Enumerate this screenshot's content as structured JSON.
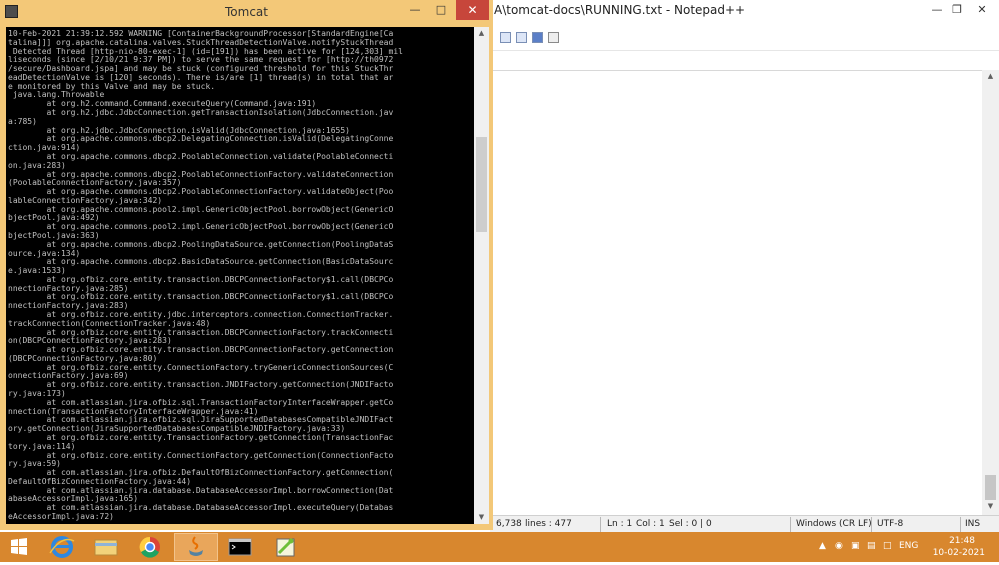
{
  "notepad": {
    "title": "A\\tomcat-docs\\RUNNING.txt - Notepad++",
    "status": {
      "length": "6,738",
      "lines": "lines : 477",
      "ln": "Ln : 1",
      "col": "Col : 1",
      "sel": "Sel : 0 | 0",
      "eol": "Windows (CR LF)",
      "encoding": "UTF-8",
      "mode": "INS"
    }
  },
  "tomcat": {
    "title": "Tomcat",
    "console_lines": [
      "10-Feb-2021 21:39:12.592 WARNING [ContainerBackgroundProcessor[StandardEngine[Ca",
      "talina]]] org.apache.catalina.valves.StuckThreadDetectionValve.notifyStuckThread",
      " Detected Thread [http-nio-80-exec-1] (id=[191]) has been active for [124,303] mil",
      "liseconds (since [2/10/21 9:37 PM]) to serve the same request for [http://th0972",
      "/secure/Dashboard.jspa] and may be stuck (configured threshold for this StuckThr",
      "eadDetectionValve is [120] seconds). There is/are [1] thread(s) in total that ar",
      "e monitored by this Valve and may be stuck.",
      " java.lang.Throwable",
      "        at org.h2.command.Command.executeQuery(Command.java:191)",
      "        at org.h2.jdbc.JdbcConnection.getTransactionIsolation(JdbcConnection.jav",
      "a:785)",
      "        at org.h2.jdbc.JdbcConnection.isValid(JdbcConnection.java:1655)",
      "        at org.apache.commons.dbcp2.DelegatingConnection.isValid(DelegatingConne",
      "ction.java:914)",
      "        at org.apache.commons.dbcp2.PoolableConnection.validate(PoolableConnecti",
      "on.java:283)",
      "        at org.apache.commons.dbcp2.PoolableConnectionFactory.validateConnection",
      "(PoolableConnectionFactory.java:357)",
      "        at org.apache.commons.dbcp2.PoolableConnectionFactory.validateObject(Poo",
      "lableConnectionFactory.java:342)",
      "        at org.apache.commons.pool2.impl.GenericObjectPool.borrowObject(GenericO",
      "bjectPool.java:492)",
      "        at org.apache.commons.pool2.impl.GenericObjectPool.borrowObject(GenericO",
      "bjectPool.java:363)",
      "        at org.apache.commons.dbcp2.PoolingDataSource.getConnection(PoolingDataS",
      "ource.java:134)",
      "        at org.apache.commons.dbcp2.BasicDataSource.getConnection(BasicDataSourc",
      "e.java:1533)",
      "        at org.ofbiz.core.entity.transaction.DBCPConnectionFactory$1.call(DBCPCo",
      "nnectionFactory.java:285)",
      "        at org.ofbiz.core.entity.transaction.DBCPConnectionFactory$1.call(DBCPCo",
      "nnectionFactory.java:283)",
      "        at org.ofbiz.core.entity.jdbc.interceptors.connection.ConnectionTracker.",
      "trackConnection(ConnectionTracker.java:48)",
      "        at org.ofbiz.core.entity.transaction.DBCPConnectionFactory.trackConnecti",
      "on(DBCPConnectionFactory.java:283)",
      "        at org.ofbiz.core.entity.transaction.DBCPConnectionFactory.getConnection",
      "(DBCPConnectionFactory.java:80)",
      "        at org.ofbiz.core.entity.ConnectionFactory.tryGenericConnectionSources(C",
      "onnectionFactory.java:69)",
      "        at org.ofbiz.core.entity.transaction.JNDIFactory.getConnection(JNDIFacto",
      "ry.java:173)",
      "        at com.atlassian.jira.ofbiz.sql.TransactionFactoryInterfaceWrapper.getCo",
      "nnection(TransactionFactoryInterfaceWrapper.java:41)",
      "        at com.atlassian.jira.ofbiz.sql.JiraSupportedDatabasesCompatibleJNDIFact",
      "ory.getConnection(JiraSupportedDatabasesCompatibleJNDIFactory.java:33)",
      "        at org.ofbiz.core.entity.TransactionFactory.getConnection(TransactionFac",
      "tory.java:114)",
      "        at org.ofbiz.core.entity.ConnectionFactory.getConnection(ConnectionFacto",
      "ry.java:59)",
      "        at com.atlassian.jira.ofbiz.DefaultOfBizConnectionFactory.getConnection(",
      "DefaultOfBizConnectionFactory.java:44)",
      "        at com.atlassian.jira.database.DatabaseAccessorImpl.borrowConnection(Dat",
      "abaseAccessorImpl.java:165)",
      "        at com.atlassian.jira.database.DatabaseAccessorImpl.executeQuery(Databas",
      "eAccessorImpl.java:72)"
    ]
  },
  "taskbar": {
    "tray": {
      "language": "ENG",
      "time": "21:48",
      "date": "10-02-2021"
    }
  },
  "colors": {
    "accent": "#d8872e",
    "tomcat_frame": "#f3c878",
    "close_button": "#c7463b"
  }
}
